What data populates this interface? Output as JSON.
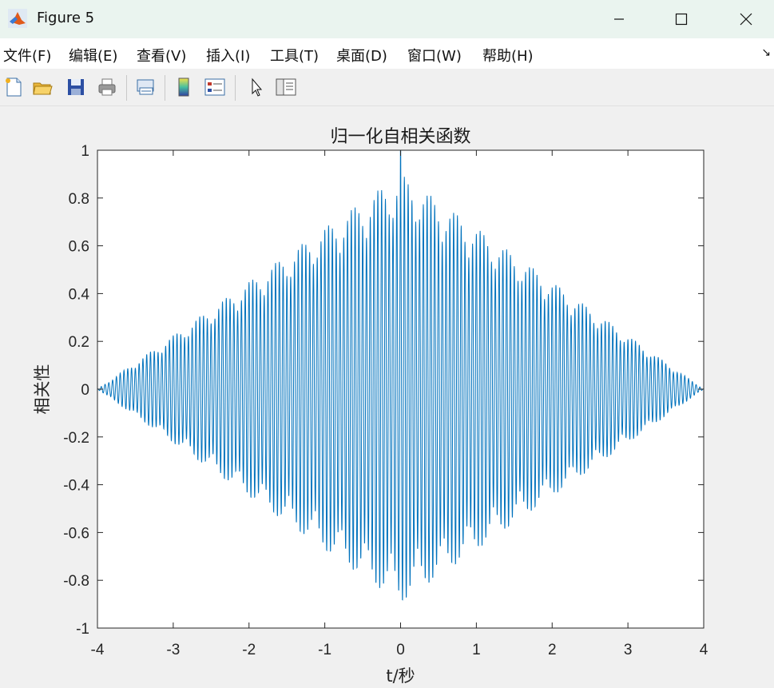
{
  "window": {
    "title": "Figure 5"
  },
  "menu": [
    "文件(F)",
    "编辑(E)",
    "查看(V)",
    "插入(I)",
    "工具(T)",
    "桌面(D)",
    "窗口(W)",
    "帮助(H)"
  ],
  "menu_arrow": "↘",
  "toolbar_icons": [
    "new-figure-icon",
    "open-file-icon",
    "save-icon",
    "print-icon",
    "link-plot-icon",
    "insert-colorbar-icon",
    "insert-legend-icon",
    "edit-plot-pointer-icon",
    "property-inspector-icon"
  ],
  "chart_data": {
    "type": "line",
    "title": "归一化自相关函数",
    "xlabel": "t/秒",
    "ylabel": "相关性",
    "xlim": [
      -4,
      4
    ],
    "ylim": [
      -1,
      1
    ],
    "xticks": [
      "-4",
      "-3",
      "-2",
      "-1",
      "0",
      "1",
      "2",
      "3",
      "4"
    ],
    "yticks": [
      "1",
      "0.8",
      "0.6",
      "0.4",
      "0.2",
      "0",
      "-0.2",
      "-0.4",
      "-0.6",
      "-0.8",
      "-1"
    ],
    "series": [
      {
        "description": "oscillating autocorrelation with triangular envelope",
        "envelope_peak": 0.9,
        "peak_at_zero": 1.0,
        "x_range": [
          -4,
          4
        ],
        "oscillation_frequency_hz": 20,
        "color": "#0072bd"
      }
    ],
    "grid": false
  }
}
